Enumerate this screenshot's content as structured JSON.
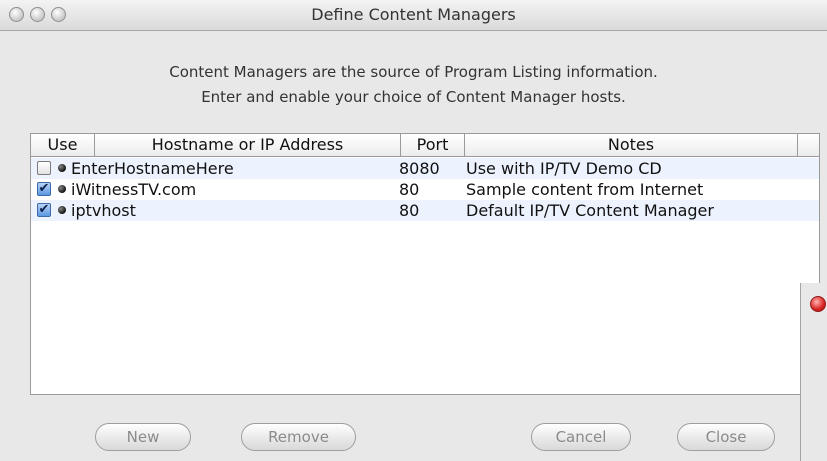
{
  "window": {
    "title": "Define Content Managers"
  },
  "description": {
    "line1": "Content Managers are the source of Program Listing information.",
    "line2": "Enter and enable your choice of Content Manager hosts."
  },
  "table": {
    "columns": [
      "Use",
      "Hostname or IP Address",
      "Port",
      "Notes"
    ],
    "rows": [
      {
        "use": false,
        "hostname": "EnterHostnameHere",
        "port": "8080",
        "notes": "Use with IP/TV Demo CD"
      },
      {
        "use": true,
        "hostname": "iWitnessTV.com",
        "port": "80",
        "notes": "Sample content from Internet"
      },
      {
        "use": true,
        "hostname": "iptvhost",
        "port": "80",
        "notes": "Default IP/TV Content Manager"
      }
    ]
  },
  "buttons": {
    "new": "New",
    "remove": "Remove",
    "cancel": "Cancel",
    "close": "Close"
  },
  "colors": {
    "accent_checkbox": "#5a97e0",
    "row_alternate": "#edf3fe",
    "close_button_red": "#d8231f"
  },
  "icons": {
    "window_controls": [
      "close-icon",
      "minimize-icon",
      "zoom-icon"
    ],
    "row_status": "status-dot-icon",
    "checkbox_checked": "checkmark-icon"
  }
}
